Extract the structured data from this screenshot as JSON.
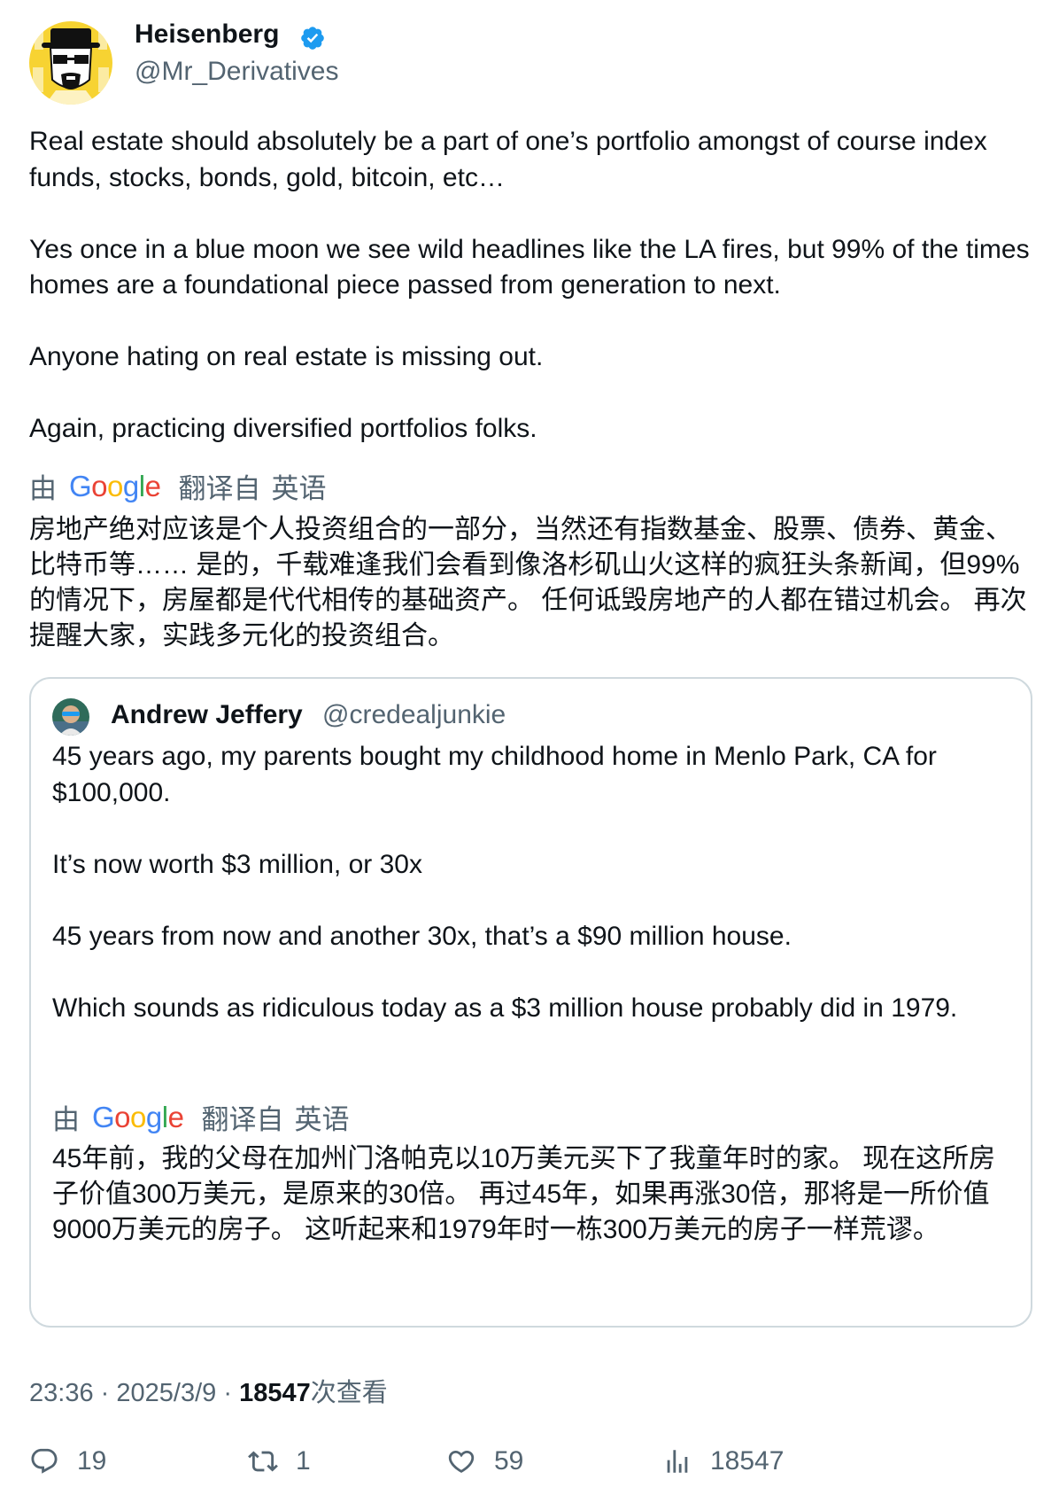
{
  "author": {
    "name": "Heisenberg",
    "handle": "@Mr_Derivatives",
    "avatar_icon": "heisenberg-avatar-icon",
    "verified_icon": "verified-badge-icon",
    "verified_color": "#1d9bf0",
    "avatar_bg": "#f7d332"
  },
  "tweet": {
    "paragraphs": [
      "Real estate should absolutely be a part of one’s portfolio amongst of course index funds, stocks, bonds, gold, bitcoin, etc…",
      "Yes once in a blue moon we see wild headlines like the LA fires, but 99% of the times homes are a foundational piece passed from generation to next.",
      "Anyone hating on real estate is missing out.",
      "Again, practicing diversified portfolios folks."
    ],
    "translation": {
      "by": "由",
      "translated_from": "翻译自",
      "language": "英语",
      "text": "房地产绝对应该是个人投资组合的一部分，当然还有指数基金、股票、债券、黄金、比特币等…… 是的，千载难逢我们会看到像洛杉矶山火这样的疯狂头条新闻，但99%的情况下，房屋都是代代相传的基础资产。 任何诋毁房地产的人都在错过机会。 再次提醒大家，实践多元化的投资组合。"
    }
  },
  "google_logo": {
    "letters": [
      "G",
      "o",
      "o",
      "g",
      "l",
      "e"
    ],
    "colors": [
      "#4285f4",
      "#ea4335",
      "#fbbc05",
      "#4285f4",
      "#34a853",
      "#ea4335"
    ]
  },
  "quoted": {
    "name": "Andrew Jeffery",
    "handle": "@credealjunkie",
    "avatar_icon": "andrew-avatar-icon",
    "paragraphs": [
      "45 years ago, my parents bought my childhood home in Menlo Park, CA for $100,000.",
      "It’s now worth $3 million, or 30x",
      "45 years from now and another 30x, that’s a $90 million house.",
      "Which sounds as ridiculous today as a $3 million house probably did in 1979."
    ],
    "translation": {
      "by": "由",
      "translated_from": "翻译自",
      "language": "英语",
      "text": "45年前，我的父母在加州门洛帕克以10万美元买下了我童年时的家。 现在这所房子价值300万美元，是原来的30倍。 再过45年，如果再涨30倍，那将是一所价值9000万美元的房子。 这听起来和1979年时一栋300万美元的房子一样荒谬。"
    }
  },
  "meta": {
    "time": "23:36",
    "separator": "·",
    "date": "2025/3/9",
    "views_count": "18547",
    "views_label": "次查看"
  },
  "actions": {
    "replies": {
      "icon": "reply-icon",
      "count": "19"
    },
    "retweets": {
      "icon": "retweet-icon",
      "count": "1"
    },
    "likes": {
      "icon": "heart-icon",
      "count": "59"
    },
    "views": {
      "icon": "analytics-icon",
      "count": "18547"
    }
  }
}
